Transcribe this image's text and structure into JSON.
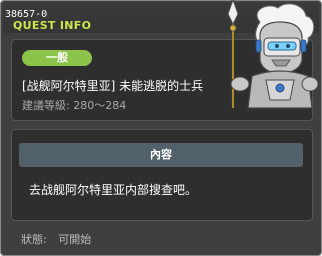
{
  "header": {
    "quest_id": "38657-0",
    "section_label": "QUEST INFO"
  },
  "quest": {
    "badge": "一般",
    "title": "[战舰阿尔特里亚] 未能逃脱的士兵",
    "level_label": "建議等級:",
    "level_range": "280～284"
  },
  "content": {
    "header": "內容",
    "description": "去战舰阿尔特里亚内部搜查吧。"
  },
  "status": {
    "label": "狀態:",
    "value": "可開始"
  },
  "colors": {
    "accent_green": "#8cc34a",
    "info_label": "#cbe94f",
    "header_bar": "#52606a"
  },
  "npc_icon": "armored-knight-portrait"
}
